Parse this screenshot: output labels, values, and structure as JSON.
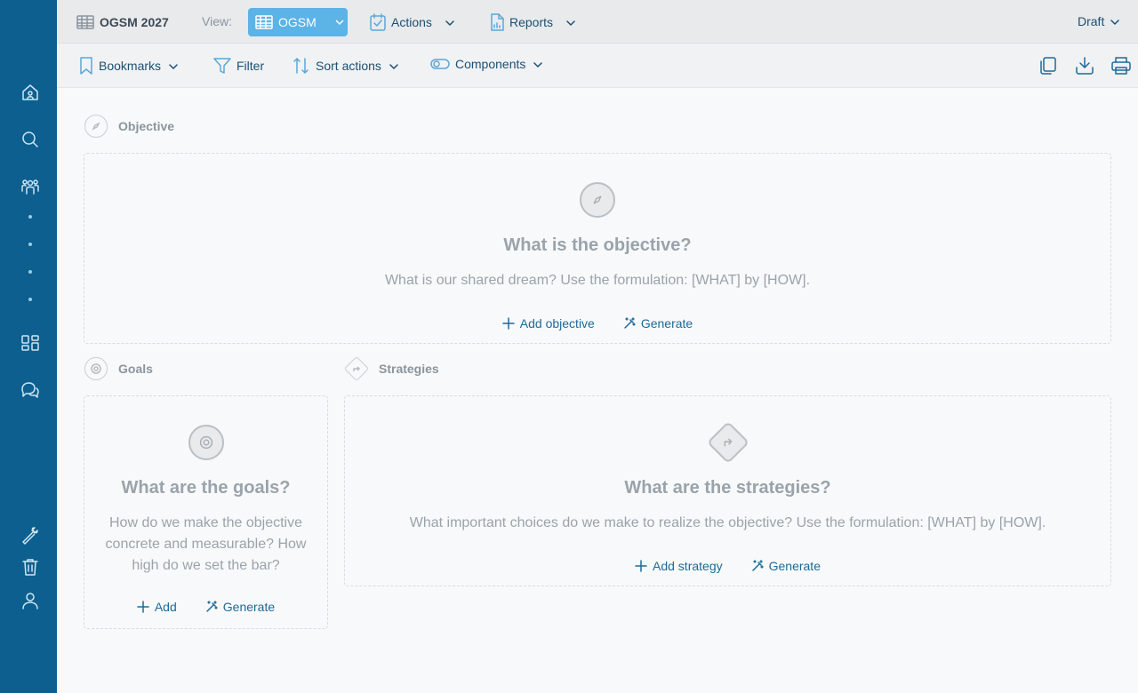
{
  "header": {
    "title": "OGSM 2027",
    "view_label": "View:",
    "view_value": "OGSM",
    "actions_label": "Actions",
    "reports_label": "Reports",
    "status": "Draft"
  },
  "toolbar": {
    "bookmarks": "Bookmarks",
    "filter": "Filter",
    "sort": "Sort actions",
    "components": "Components"
  },
  "objective": {
    "section": "Objective",
    "title": "What is the objective?",
    "desc": "What is our shared dream? Use the formulation: [WHAT] by [HOW].",
    "add": "Add objective",
    "generate": "Generate"
  },
  "goals": {
    "section": "Goals",
    "title": "What are the goals?",
    "desc_1": "How do we make the objective",
    "desc_2": "concrete and measurable? How",
    "desc_3": "high do we set the bar?",
    "add": "Add",
    "generate": "Generate"
  },
  "strategies": {
    "section": "Strategies",
    "title": "What are the strategies?",
    "desc": "What important choices do we make to realize the objective? Use the formulation: [WHAT] by [HOW].",
    "add": "Add strategy",
    "generate": "Generate"
  },
  "colors": {
    "sidebar": "#0c5f8f",
    "accent": "#5bb3e6",
    "link": "#1d6a99"
  }
}
